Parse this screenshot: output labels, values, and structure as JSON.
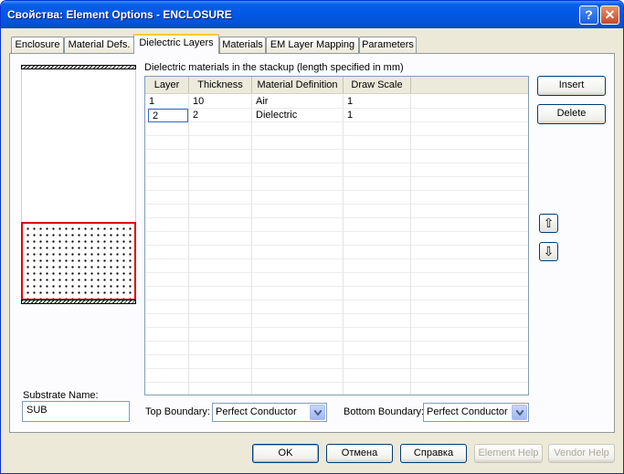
{
  "window": {
    "title": "Свойства: Element Options - ENCLOSURE",
    "help_glyph": "?",
    "close_glyph": "✕"
  },
  "tabs": [
    {
      "label": "Enclosure"
    },
    {
      "label": "Material Defs."
    },
    {
      "label": "Dielectric Layers",
      "active": true
    },
    {
      "label": "Materials"
    },
    {
      "label": "EM Layer Mapping"
    },
    {
      "label": "Parameters"
    }
  ],
  "stackup": {
    "caption": "Dielectric materials in the stackup (length specified in mm)",
    "columns": [
      "Layer",
      "Thickness",
      "Material Definition",
      "Draw Scale"
    ],
    "rows": [
      {
        "layer": "1",
        "thickness": "10",
        "material": "Air",
        "scale": "1"
      },
      {
        "layer": "2",
        "thickness": "2",
        "material": "Dielectric",
        "scale": "1"
      }
    ]
  },
  "side_buttons": {
    "insert": "Insert",
    "delete": "Delete",
    "up_glyph": "⇧",
    "down_glyph": "⇩"
  },
  "substrate": {
    "label": "Substrate Name:",
    "value": "SUB"
  },
  "boundaries": {
    "top_label": "Top Boundary:",
    "top_value": "Perfect Conductor",
    "bottom_label": "Bottom Boundary:",
    "bottom_value": "Perfect Conductor"
  },
  "footer": {
    "ok": "OK",
    "cancel": "Отмена",
    "help": "Справка",
    "element_help": "Element Help",
    "vendor_help": "Vendor Help"
  },
  "icons": {
    "help": "help-icon",
    "close": "close-icon",
    "move_up": "arrow-up-icon",
    "move_down": "arrow-down-icon",
    "dropdown": "chevron-down-icon"
  }
}
